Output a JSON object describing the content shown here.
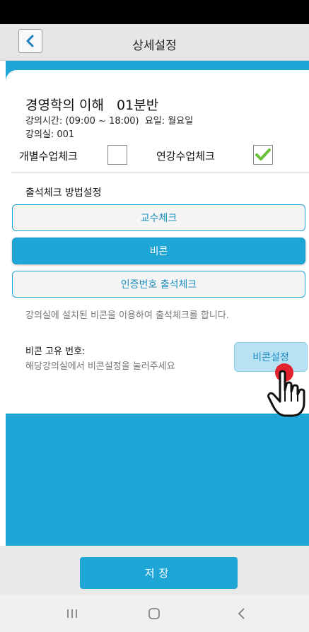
{
  "header": {
    "title": "상세설정"
  },
  "course": {
    "title": "경영학의 이해   01분반",
    "time": "강의시간: (09:00 ~ 18:00)  요일: 월요일",
    "room": "강의실: 001"
  },
  "checks": {
    "individual_label": "개별수업체크",
    "individual_checked": false,
    "consecutive_label": "연강수업체크",
    "consecutive_checked": true
  },
  "method": {
    "title": "출석체크 방법설정",
    "options": [
      "교수체크",
      "비콘",
      "인증번호 출석체크"
    ],
    "selected": "비콘",
    "description": "강의실에 설치된 비콘을 이용하여 출석체크를 합니다."
  },
  "beacon": {
    "label": "비콘 고유 번호:",
    "hint": "해당강의실에서 비콘설정을 눌러주세요",
    "button": "비콘설정"
  },
  "footer": {
    "save": "저장"
  },
  "colors": {
    "accent": "#1ea6d6",
    "tap_indicator": "#e2232e",
    "check": "#6bbf3a"
  },
  "icons": [
    "back-chevron-icon",
    "check-icon",
    "hand-pointer-icon",
    "recent-apps-icon",
    "home-icon",
    "back-icon"
  ]
}
